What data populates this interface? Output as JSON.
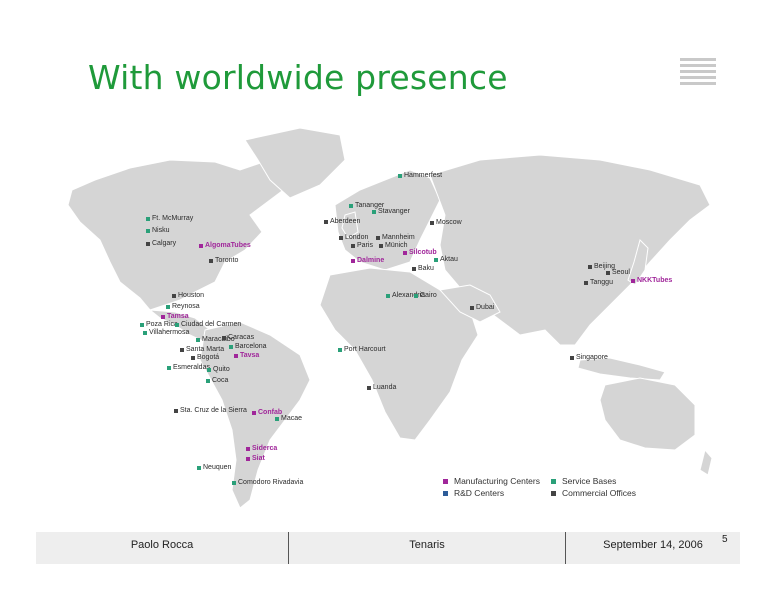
{
  "title": "With worldwide presence",
  "colors": {
    "title": "#1f9a3a",
    "manufacturing": "#a0269a",
    "service": "#2aa079",
    "rd": "#2d5c99",
    "commercial": "#444444",
    "land": "#d3d3d3"
  },
  "locations": [
    {
      "label": "Hammerfest",
      "type": "service"
    },
    {
      "label": "Tananger",
      "type": "service"
    },
    {
      "label": "Stavanger",
      "type": "service"
    },
    {
      "label": "Aberdeen",
      "type": "commercial"
    },
    {
      "label": "Moscow",
      "type": "commercial"
    },
    {
      "label": "London",
      "type": "commercial"
    },
    {
      "label": "Mannheim",
      "type": "commercial"
    },
    {
      "label": "Paris",
      "type": "commercial"
    },
    {
      "label": "Münich",
      "type": "commercial"
    },
    {
      "label": "Silcotub",
      "type": "manufacturing"
    },
    {
      "label": "Dalmine",
      "type": "manufacturing"
    },
    {
      "label": "Aktau",
      "type": "service"
    },
    {
      "label": "Baku",
      "type": "commercial"
    },
    {
      "label": "Beijing",
      "type": "commercial"
    },
    {
      "label": "Seoul",
      "type": "commercial"
    },
    {
      "label": "Tanggu",
      "type": "commercial"
    },
    {
      "label": "NKKTubes",
      "type": "manufacturing"
    },
    {
      "label": "Alexandria",
      "type": "service"
    },
    {
      "label": "Cairo",
      "type": "service"
    },
    {
      "label": "Dubai",
      "type": "commercial"
    },
    {
      "label": "Port Harcourt",
      "type": "service"
    },
    {
      "label": "Singapore",
      "type": "commercial"
    },
    {
      "label": "Luanda",
      "type": "commercial"
    },
    {
      "label": "Ft. McMurray",
      "type": "service"
    },
    {
      "label": "Nisku",
      "type": "service"
    },
    {
      "label": "Calgary",
      "type": "commercial"
    },
    {
      "label": "AlgomaTubes",
      "type": "manufacturing"
    },
    {
      "label": "Toronto",
      "type": "commercial"
    },
    {
      "label": "Houston",
      "type": "commercial"
    },
    {
      "label": "Reynosa",
      "type": "service"
    },
    {
      "label": "Tamsa",
      "type": "manufacturing"
    },
    {
      "label": "Poza Rica",
      "type": "service"
    },
    {
      "label": "Ciudad del Carmen",
      "type": "service"
    },
    {
      "label": "Villahermosa",
      "type": "service"
    },
    {
      "label": "Maracaibo",
      "type": "service"
    },
    {
      "label": "Caracas",
      "type": "commercial"
    },
    {
      "label": "Barcelona",
      "type": "service"
    },
    {
      "label": "Tavsa",
      "type": "manufacturing"
    },
    {
      "label": "Santa Marta",
      "type": "commercial"
    },
    {
      "label": "Bogotá",
      "type": "commercial"
    },
    {
      "label": "Esmeraldas",
      "type": "service"
    },
    {
      "label": "Quito",
      "type": "service"
    },
    {
      "label": "Coca",
      "type": "service"
    },
    {
      "label": "Sta. Cruz de la Sierra",
      "type": "commercial"
    },
    {
      "label": "Confab",
      "type": "manufacturing"
    },
    {
      "label": "Macae",
      "type": "service"
    },
    {
      "label": "Siderca",
      "type": "manufacturing"
    },
    {
      "label": "Siat",
      "type": "manufacturing"
    },
    {
      "label": "Neuquen",
      "type": "service"
    },
    {
      "label": "Comodoro Rivadavia",
      "type": "service"
    }
  ],
  "legend": [
    {
      "label": "Manufacturing Centers",
      "type": "manufacturing"
    },
    {
      "label": "Service Bases",
      "type": "service"
    },
    {
      "label": "R&D Centers",
      "type": "rd"
    },
    {
      "label": "Commercial Offices",
      "type": "commercial"
    }
  ],
  "footer": {
    "presenter": "Paolo Rocca",
    "company": "Tenaris",
    "date": "September 14,  2006",
    "page": "5"
  }
}
